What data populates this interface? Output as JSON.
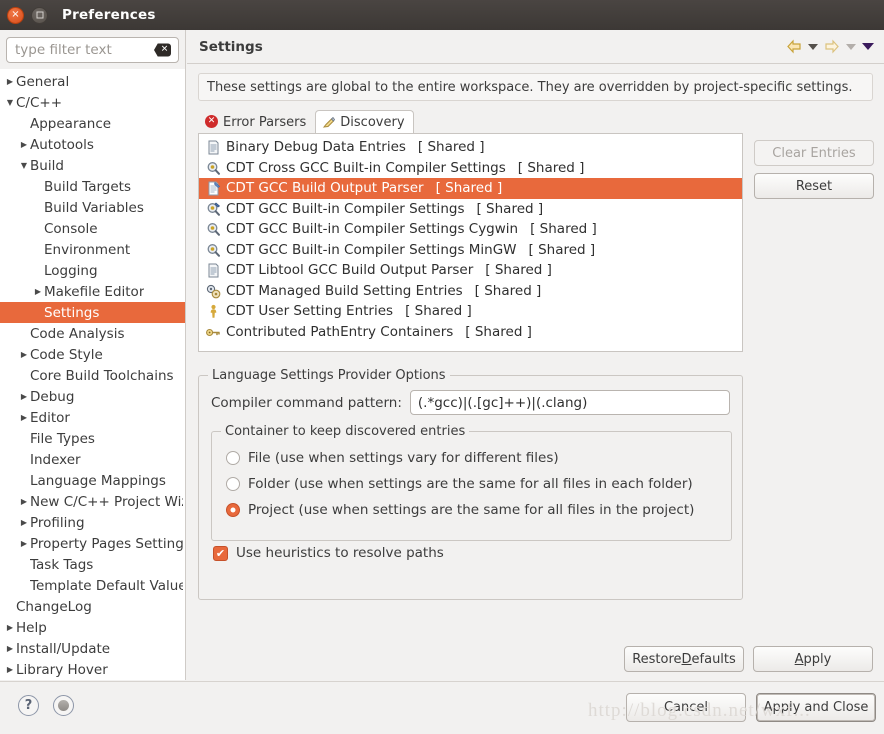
{
  "window": {
    "title": "Preferences",
    "close_label": "×",
    "maximize_label": "maximize"
  },
  "sidebar": {
    "filter": {
      "placeholder": "type filter text",
      "value": "",
      "clear_icon": "backspace-clear-icon"
    },
    "items": [
      {
        "label": "General",
        "indent": 0,
        "arrow": "collapsed",
        "selected": false
      },
      {
        "label": "C/C++",
        "indent": 0,
        "arrow": "expanded",
        "selected": false
      },
      {
        "label": "Appearance",
        "indent": 1,
        "arrow": "none",
        "selected": false
      },
      {
        "label": "Autotools",
        "indent": 1,
        "arrow": "collapsed",
        "selected": false
      },
      {
        "label": "Build",
        "indent": 1,
        "arrow": "expanded",
        "selected": false
      },
      {
        "label": "Build Targets",
        "indent": 2,
        "arrow": "none",
        "selected": false
      },
      {
        "label": "Build Variables",
        "indent": 2,
        "arrow": "none",
        "selected": false
      },
      {
        "label": "Console",
        "indent": 2,
        "arrow": "none",
        "selected": false
      },
      {
        "label": "Environment",
        "indent": 2,
        "arrow": "none",
        "selected": false
      },
      {
        "label": "Logging",
        "indent": 2,
        "arrow": "none",
        "selected": false
      },
      {
        "label": "Makefile Editor",
        "indent": 2,
        "arrow": "collapsed",
        "selected": false
      },
      {
        "label": "Settings",
        "indent": 2,
        "arrow": "none",
        "selected": true
      },
      {
        "label": "Code Analysis",
        "indent": 1,
        "arrow": "none",
        "selected": false
      },
      {
        "label": "Code Style",
        "indent": 1,
        "arrow": "collapsed",
        "selected": false
      },
      {
        "label": "Core Build Toolchains",
        "indent": 1,
        "arrow": "none",
        "selected": false
      },
      {
        "label": "Debug",
        "indent": 1,
        "arrow": "collapsed",
        "selected": false
      },
      {
        "label": "Editor",
        "indent": 1,
        "arrow": "collapsed",
        "selected": false
      },
      {
        "label": "File Types",
        "indent": 1,
        "arrow": "none",
        "selected": false
      },
      {
        "label": "Indexer",
        "indent": 1,
        "arrow": "none",
        "selected": false
      },
      {
        "label": "Language Mappings",
        "indent": 1,
        "arrow": "none",
        "selected": false
      },
      {
        "label": "New C/C++ Project Wizard",
        "indent": 1,
        "arrow": "collapsed",
        "selected": false
      },
      {
        "label": "Profiling",
        "indent": 1,
        "arrow": "collapsed",
        "selected": false
      },
      {
        "label": "Property Pages Settings",
        "indent": 1,
        "arrow": "collapsed",
        "selected": false
      },
      {
        "label": "Task Tags",
        "indent": 1,
        "arrow": "none",
        "selected": false
      },
      {
        "label": "Template Default Values",
        "indent": 1,
        "arrow": "none",
        "selected": false
      },
      {
        "label": "ChangeLog",
        "indent": 0,
        "arrow": "none",
        "selected": false
      },
      {
        "label": "Help",
        "indent": 0,
        "arrow": "collapsed",
        "selected": false
      },
      {
        "label": "Install/Update",
        "indent": 0,
        "arrow": "collapsed",
        "selected": false
      },
      {
        "label": "Library Hover",
        "indent": 0,
        "arrow": "collapsed",
        "selected": false
      }
    ]
  },
  "pane": {
    "title": "Settings",
    "nav": {
      "back_icon": "back-arrow-icon",
      "back_menu_icon": "chevron-down-icon",
      "forward_icon": "forward-arrow-icon",
      "forward_menu_icon": "chevron-down-icon",
      "view_menu_icon": "chevron-down-icon"
    },
    "info": "These settings are global to the entire workspace.  They are overridden by project-specific settings.",
    "tabs": [
      {
        "label": "Error Parsers",
        "icon": "error-icon",
        "active": false
      },
      {
        "label": "Discovery",
        "icon": "discovery-icon",
        "active": true
      }
    ],
    "providers": [
      {
        "label": "Binary Debug Data Entries",
        "shared": "[ Shared ]",
        "icon": "document-icon",
        "selected": false
      },
      {
        "label": "CDT Cross GCC Built-in Compiler Settings",
        "shared": "[ Shared ]",
        "icon": "magnifier-icon",
        "selected": false
      },
      {
        "label": "CDT GCC Build Output Parser",
        "shared": "[ Shared ]",
        "icon": "document-edit-icon",
        "selected": true
      },
      {
        "label": "CDT GCC Built-in Compiler Settings",
        "shared": "[ Shared ]",
        "icon": "magnifier-edit-icon",
        "selected": false
      },
      {
        "label": "CDT GCC Built-in Compiler Settings Cygwin",
        "shared": "[ Shared ]",
        "icon": "magnifier-icon",
        "selected": false
      },
      {
        "label": "CDT GCC Built-in Compiler Settings MinGW",
        "shared": "[ Shared ]",
        "icon": "magnifier-icon",
        "selected": false
      },
      {
        "label": "CDT Libtool GCC Build Output Parser",
        "shared": "[ Shared ]",
        "icon": "document-icon",
        "selected": false
      },
      {
        "label": "CDT Managed Build Setting Entries",
        "shared": "[ Shared ]",
        "icon": "gears-icon",
        "selected": false
      },
      {
        "label": "CDT User Setting Entries",
        "shared": "[ Shared ]",
        "icon": "person-icon",
        "selected": false
      },
      {
        "label": "Contributed PathEntry Containers",
        "shared": "[ Shared ]",
        "icon": "key-icon",
        "selected": false
      }
    ],
    "side_buttons": [
      {
        "label": "Clear Entries",
        "enabled": false
      },
      {
        "label": "Reset",
        "enabled": true
      }
    ],
    "options_group": {
      "title": "Language Settings Provider Options",
      "pattern_label": "Compiler command pattern:",
      "pattern_value": "(.*gcc)|(.[gc]++)|(.clang)",
      "container_group_title": "Container to keep discovered entries",
      "radios": [
        {
          "label": "File (use when settings vary for different files)",
          "selected": false
        },
        {
          "label": "Folder (use when settings are the same for all files in each folder)",
          "selected": false
        },
        {
          "label": "Project (use when settings are the same for all files in the project)",
          "selected": true
        }
      ],
      "heuristics": {
        "label": "Use heuristics to resolve paths",
        "checked": true,
        "check_glyph": "✔"
      }
    },
    "buttons": {
      "restore_defaults_pre": "Restore ",
      "restore_defaults_mnemonic": "D",
      "restore_defaults_post": "efaults",
      "apply_mnemonic": "A",
      "apply_post": "pply"
    }
  },
  "footer": {
    "help_icon": "help-icon",
    "help_glyph": "?",
    "secondary_icon": "shell-status-icon",
    "cancel_label": "Cancel",
    "apply_close_label": "Apply and Close",
    "watermark": "http://blog.csdn.net/wxf..."
  }
}
